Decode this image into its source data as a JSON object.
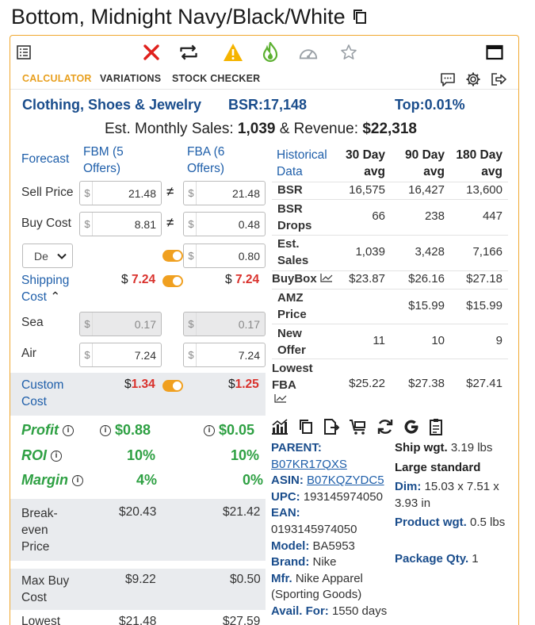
{
  "title": "Bottom, Midnight Navy/Black/White",
  "tabs": [
    "CALCULATOR",
    "VARIATIONS",
    "STOCK CHECKER"
  ],
  "colors": {
    "accent": "#e8a020",
    "blue": "#1f5faa",
    "green": "#2ea043",
    "red": "#d9312c"
  },
  "summary": {
    "category": "Clothing, Shoes & Jewelry",
    "bsr": "BSR:17,148",
    "top": "Top:0.01%",
    "est_label": "Est. Monthly Sales:",
    "est_sales": "1,039",
    "rev_label": "& Revenue:",
    "revenue": "$22,318"
  },
  "calc": {
    "forecast": "Forecast",
    "fbm_head": "FBM (5 Offers)",
    "fba_head": "FBA (6 Offers)",
    "sell_label": "Sell Price",
    "sell_fbm": "21.48",
    "sell_fba": "21.48",
    "buy_label": "Buy Cost",
    "buy_fbm": "8.81",
    "buy_fba": "0.48",
    "select_value": "De",
    "prep_fba": "0.80",
    "shipping_label": "Shipping Cost",
    "ship_fbm": "7.24",
    "ship_fba": "7.24",
    "sea_label": "Sea",
    "sea_fbm": "0.17",
    "sea_fba": "0.17",
    "air_label": "Air",
    "air_fbm": "7.24",
    "air_fba": "7.24",
    "custom_label": "Custom Cost",
    "custom_fbm": "1.34",
    "custom_fba": "1.25",
    "profit_label": "Profit",
    "profit_fbm": "$0.88",
    "profit_fba": "$0.05",
    "roi_label": "ROI",
    "roi_fbm": "10%",
    "roi_fba": "10%",
    "margin_label": "Margin",
    "margin_fbm": "4%",
    "margin_fba": "0%",
    "breakeven_label": "Break-even Price",
    "breakeven_fbm": "$20.43",
    "breakeven_fba": "$21.42",
    "maxbuy_label": "Max Buy Cost",
    "maxbuy_fbm": "$9.22",
    "maxbuy_fba": "$0.50",
    "lowest_label": "Lowest",
    "lowest_fbm": "$21.48",
    "lowest_fba": "$27.59",
    "currency": "$"
  },
  "historical": {
    "header": [
      "Historical Data",
      "30 Day avg",
      "90 Day avg",
      "180 Day avg"
    ],
    "rows": [
      {
        "label": "BSR",
        "v30": "16,575",
        "v90": "16,427",
        "v180": "13,600"
      },
      {
        "label": "BSR Drops",
        "v30": "66",
        "v90": "238",
        "v180": "447"
      },
      {
        "label": "Est. Sales",
        "v30": "1,039",
        "v90": "3,428",
        "v180": "7,166"
      },
      {
        "label": "BuyBox",
        "v30": "$23.87",
        "v90": "$26.16",
        "v180": "$27.18"
      },
      {
        "label": "AMZ Price",
        "v30": "",
        "v90": "$15.99",
        "v180": "$15.99"
      },
      {
        "label": "New Offer",
        "v30": "11",
        "v90": "10",
        "v180": "9"
      },
      {
        "label": "Lowest FBA",
        "v30": "$25.22",
        "v90": "$27.38",
        "v180": "$27.41"
      }
    ]
  },
  "product": {
    "parent_label": "PARENT:",
    "parent": "B07KR17QXS",
    "asin_label": "ASIN:",
    "asin": "B07KQZYDC5",
    "upc_label": "UPC:",
    "upc": "193145974050",
    "ean_label": "EAN:",
    "ean": "0193145974050",
    "model_label": "Model:",
    "model": "BA5953",
    "brand_label": "Brand:",
    "brand": "Nike",
    "mfr_label": "Mfr.",
    "mfr": "Nike Apparel (Sporting Goods)",
    "avail_label": "Avail. For:",
    "avail": "1550 days",
    "ship_wgt_label": "Ship wgt.",
    "ship_wgt": "3.19 lbs",
    "size_tier": "Large standard",
    "dim_label": "Dim:",
    "dim": "15.03 x 7.51 x 3.93 in",
    "prod_wgt_label": "Product wgt.",
    "prod_wgt": "0.5 lbs",
    "pkg_label": "Package Qty.",
    "pkg": "1"
  }
}
